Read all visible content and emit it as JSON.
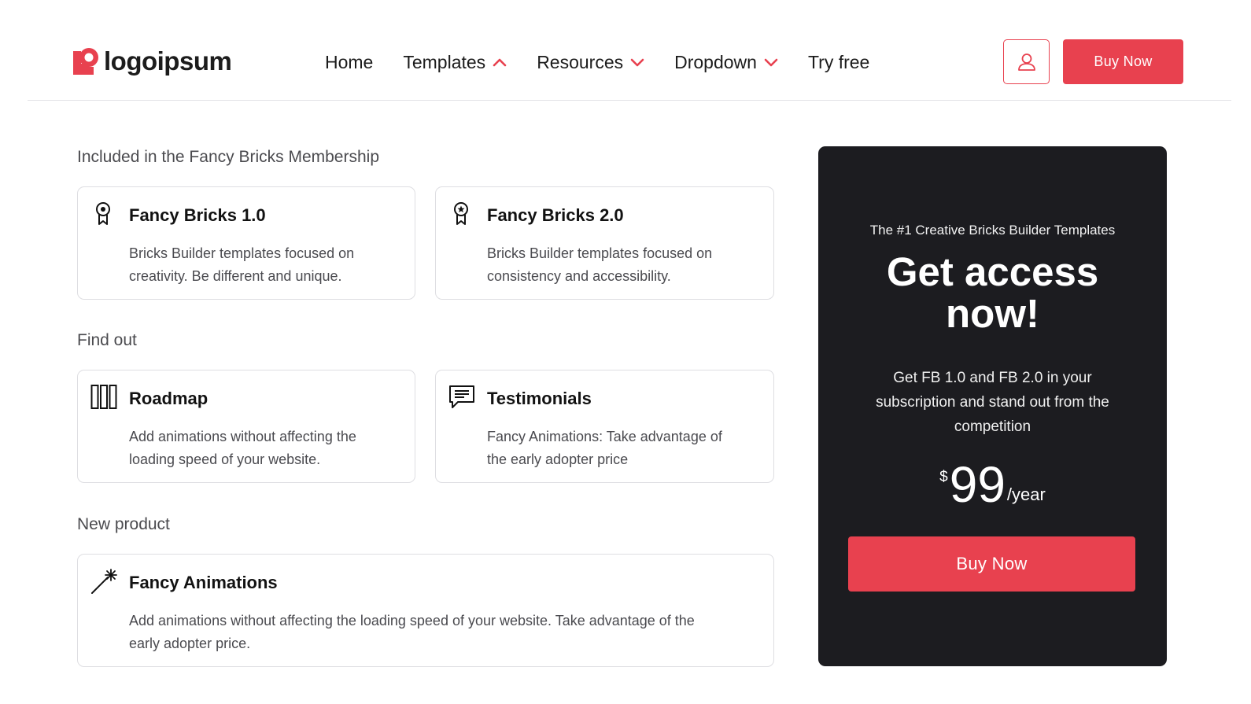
{
  "brand": {
    "name": "logoipsum",
    "accent": "#e8414f",
    "dark": "#1c1c20"
  },
  "nav": {
    "items": [
      {
        "label": "Home",
        "icon": null
      },
      {
        "label": "Templates",
        "icon": "chevron-up-icon"
      },
      {
        "label": "Resources",
        "icon": "chevron-down-icon"
      },
      {
        "label": "Dropdown",
        "icon": "chevron-down-icon"
      },
      {
        "label": "Try free",
        "icon": null
      }
    ],
    "user_icon": "user-icon",
    "buy_label": "Buy Now"
  },
  "sections": [
    {
      "title": "Included in the Fancy Bricks Membership",
      "cards": [
        {
          "icon": "award-ribbon-icon",
          "title": "Fancy Bricks 1.0",
          "desc_lines": [
            "Bricks Builder templates focused on",
            "creativity. Be different and unique."
          ]
        },
        {
          "icon": "star-badge-icon",
          "title": "Fancy Bricks 2.0",
          "desc_lines": [
            "Bricks Builder templates focused on",
            "consistency and accessibility."
          ]
        }
      ]
    },
    {
      "title": "Find out",
      "cards": [
        {
          "icon": "columns-icon",
          "title": "Roadmap",
          "desc_lines": [
            "Add animations without affecting the",
            "loading speed of your website."
          ]
        },
        {
          "icon": "message-icon",
          "title": "Testimonials",
          "desc_lines": [
            "Fancy Animations: Take advantage of",
            "the early adopter price"
          ]
        }
      ]
    },
    {
      "title": "New product",
      "cards": [
        {
          "icon": "magic-wand-icon",
          "title": "Fancy Animations",
          "desc_lines": [
            "Add animations without affecting the loading speed of your website. Take advantage of the",
            "early adopter price."
          ]
        }
      ]
    }
  ],
  "promo": {
    "kicker": "The #1 Creative Bricks Builder Templates",
    "heading_lines": [
      "Get access",
      "now!"
    ],
    "desc_lines": [
      "Get FB 1.0 and FB 2.0 in your",
      "subscription and stand out from the",
      "competition"
    ],
    "price": {
      "currency": "$",
      "amount": "99",
      "period": "/year"
    },
    "buy_label": "Buy Now"
  }
}
